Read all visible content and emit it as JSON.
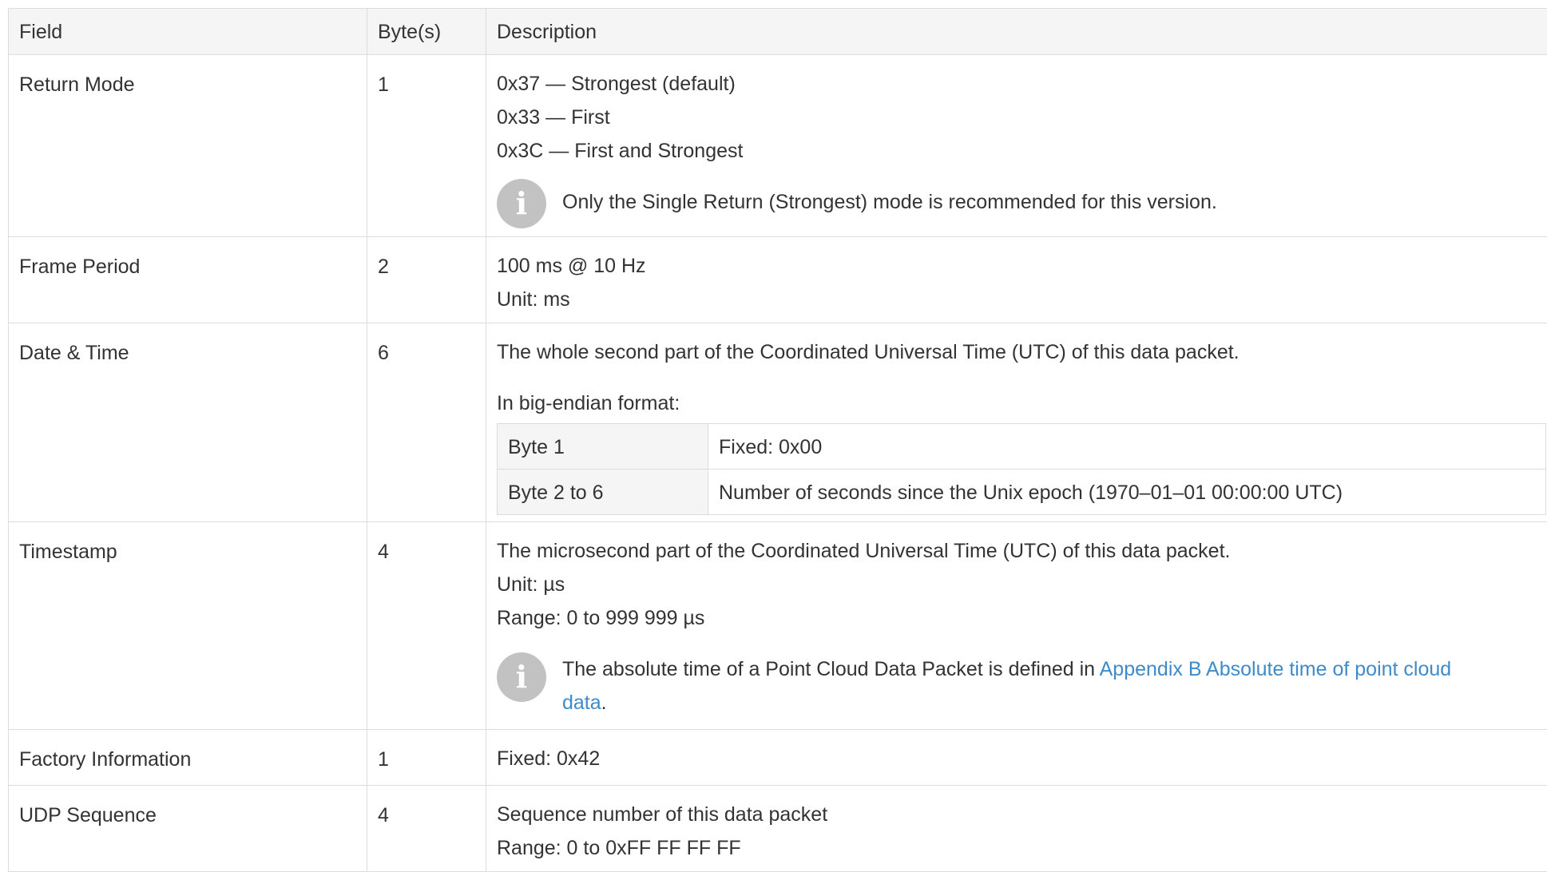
{
  "header": {
    "field": "Field",
    "bytes": "Byte(s)",
    "description": "Description"
  },
  "rows": {
    "return_mode": {
      "field": "Return Mode",
      "bytes": "1",
      "lines": [
        "0x37 — Strongest (default)",
        "0x33 — First",
        "0x3C — First and Strongest"
      ],
      "note": "Only the Single Return (Strongest) mode is recommended for this version.",
      "note_icon": "info-icon"
    },
    "frame_period": {
      "field": "Frame Period",
      "bytes": "2",
      "lines": [
        "100 ms @ 10 Hz",
        "Unit: ms"
      ]
    },
    "date_time": {
      "field": "Date & Time",
      "bytes": "6",
      "para1": "The whole second part of the Coordinated Universal Time (UTC) of this data packet.",
      "para2": "In big-endian format:",
      "sub_rows": [
        {
          "key": "Byte 1",
          "value": "Fixed: 0x00"
        },
        {
          "key": "Byte 2 to 6",
          "value": "Number of seconds since the Unix epoch (1970–01–01 00:00:00 UTC)"
        }
      ]
    },
    "timestamp": {
      "field": "Timestamp",
      "bytes": "4",
      "lines": [
        "The microsecond part of the Coordinated Universal Time (UTC) of this data packet.",
        "Unit: µs",
        "Range: 0 to 999 999 µs"
      ],
      "note_prefix": "The absolute time of a Point Cloud Data Packet is defined in ",
      "note_link": "Appendix B Absolute time of point cloud data",
      "note_suffix": ".",
      "note_icon": "info-icon"
    },
    "factory_info": {
      "field": "Factory Information",
      "bytes": "1",
      "lines": [
        "Fixed: 0x42"
      ]
    },
    "udp_sequence": {
      "field": "UDP Sequence",
      "bytes": "4",
      "lines": [
        "Sequence number of this data packet",
        "Range: 0 to 0xFF FF FF FF"
      ]
    }
  },
  "colors": {
    "text": "#333333",
    "border": "#dcdcdc",
    "header_bg": "#f5f5f5",
    "link": "#3f8bc9",
    "icon_bg": "#c2c2c2"
  }
}
